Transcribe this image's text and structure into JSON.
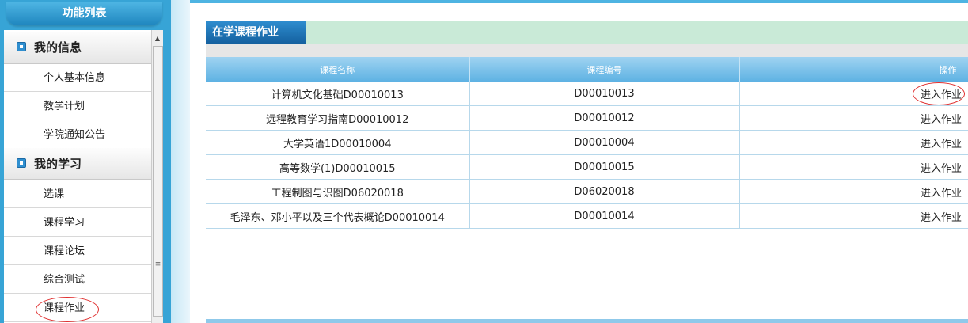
{
  "sidebar": {
    "title": "功能列表",
    "sections": [
      {
        "label": "我的信息",
        "items": [
          "个人基本信息",
          "教学计划",
          "学院通知公告"
        ]
      },
      {
        "label": "我的学习",
        "items": [
          "选课",
          "课程学习",
          "课程论坛",
          "综合测试",
          "课程作业"
        ]
      }
    ],
    "scroll_thumb_glyph": "≡",
    "scroll_up_glyph": "▲"
  },
  "main": {
    "title": "在学课程作业",
    "columns": [
      "课程名称",
      "课程编号",
      "操作"
    ],
    "rows": [
      {
        "name": "计算机文化基础D00010013",
        "code": "D00010013",
        "action": "进入作业"
      },
      {
        "name": "远程教育学习指南D00010012",
        "code": "D00010012",
        "action": "进入作业"
      },
      {
        "name": "大学英语1D00010004",
        "code": "D00010004",
        "action": "进入作业"
      },
      {
        "name": "高等数学(1)D00010015",
        "code": "D00010015",
        "action": "进入作业"
      },
      {
        "name": "工程制图与识图D06020018",
        "code": "D06020018",
        "action": "进入作业"
      },
      {
        "name": "毛泽东、邓小平以及三个代表概论D00010014",
        "code": "D00010014",
        "action": "进入作业"
      }
    ]
  },
  "colors": {
    "accent": "#37a4d6",
    "title_bar": "#c9ead7",
    "annotation_red": "#e03030"
  }
}
